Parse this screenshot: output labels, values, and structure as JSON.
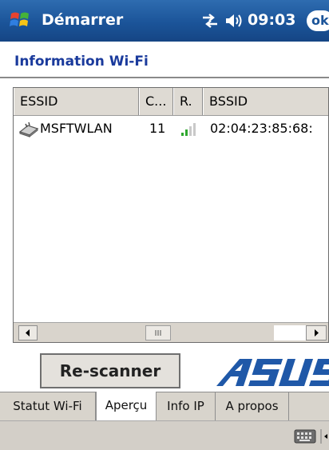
{
  "taskbar": {
    "start_label": "Démarrer",
    "time": "09:03",
    "ok_label": "ok",
    "icons": [
      "windows-flag-icon",
      "connectivity-icon",
      "speaker-icon"
    ]
  },
  "page": {
    "title": "Information Wi-Fi"
  },
  "table": {
    "columns": [
      "ESSID",
      "C...",
      "R.",
      "BSSID"
    ],
    "rows": [
      {
        "essid": "MSFTWLAN",
        "channel": "11",
        "signal_icon": "signal-bars-icon",
        "bssid": "02:04:23:85:68:"
      }
    ]
  },
  "actions": {
    "rescan_label": "Re-scanner"
  },
  "logo": {
    "text": "ASUS"
  },
  "tabs": [
    {
      "label": "Statut Wi-Fi",
      "active": false
    },
    {
      "label": "Aperçu",
      "active": true
    },
    {
      "label": "Info IP",
      "active": false
    },
    {
      "label": "A propos",
      "active": false
    }
  ],
  "menu_bar": {
    "icons": [
      "keyboard-icon",
      "sip-arrow-icon"
    ]
  },
  "colors": {
    "taskbar": "#1b5499",
    "title": "#1a3a9c",
    "logo": "#1f58a8",
    "signal": "#2fa82f"
  }
}
